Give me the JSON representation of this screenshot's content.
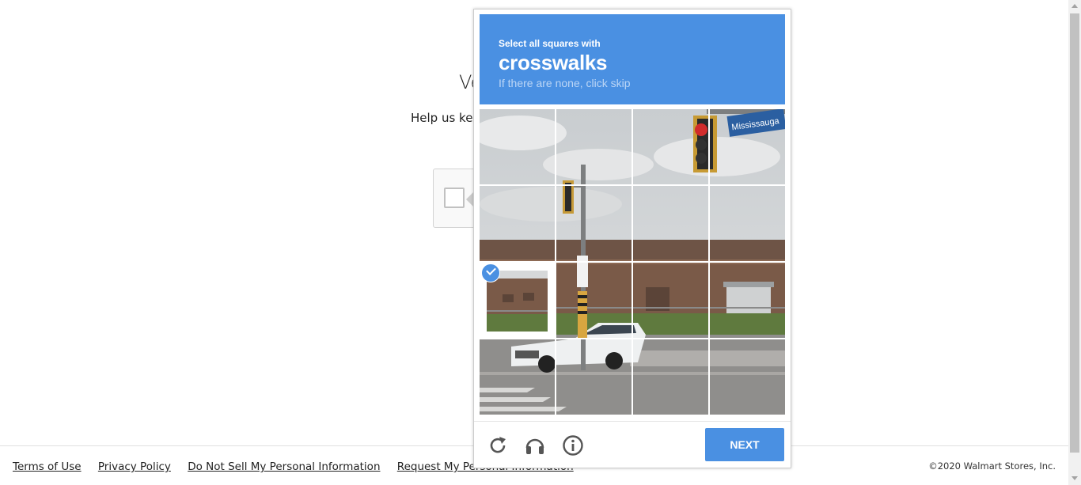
{
  "page": {
    "title_partial": "Ve",
    "subtitle_partial": "Help us kee"
  },
  "footer": {
    "links": [
      "Terms of Use",
      "Privacy Policy",
      "Do Not Sell My Personal Information",
      "Request My Personal Information"
    ],
    "copyright": "©2020 Walmart Stores, Inc."
  },
  "captcha": {
    "instruction": "Select all squares with",
    "keyword": "crosswalks",
    "hint": "If there are none, click skip",
    "grid": {
      "rows": 4,
      "cols": 4,
      "selected_tiles": [
        {
          "row": 3,
          "col": 1
        }
      ]
    },
    "image_sign_text": "Mississauga",
    "controls": {
      "reload": "reload-icon",
      "audio": "headphones-icon",
      "info": "info-icon"
    },
    "next_label": "NEXT"
  },
  "colors": {
    "accent": "#4a90e2",
    "header_hint": "#bcd6f6"
  }
}
